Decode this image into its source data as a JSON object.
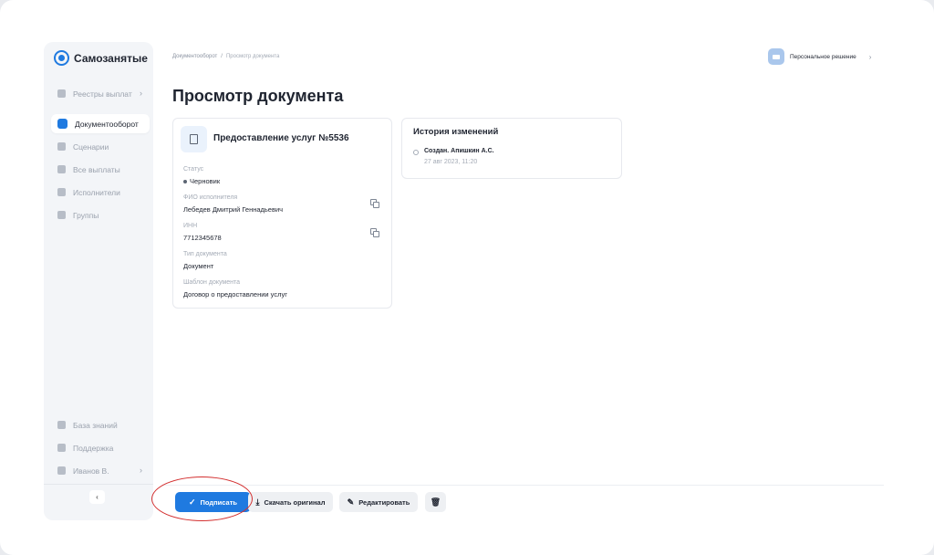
{
  "brand": {
    "name": "Самозанятые"
  },
  "sidebar": {
    "items": [
      {
        "label": "Реестры выплат",
        "has_chevron": true,
        "chevron": "›"
      },
      {
        "label": "Документооборот",
        "active": true
      },
      {
        "label": "Сценарии"
      },
      {
        "label": "Все выплаты"
      },
      {
        "label": "Исполнители"
      },
      {
        "label": "Группы"
      }
    ],
    "bottom_items": [
      {
        "label": "База знаний"
      },
      {
        "label": "Поддержка"
      },
      {
        "label": "Иванов В.",
        "has_chevron": true,
        "chevron": "›"
      }
    ],
    "collapse_glyph": "‹"
  },
  "header": {
    "breadcrumb": [
      "Документооборот",
      "Просмотр документа"
    ],
    "breadcrumb_separator": "/",
    "account_name": "Персональное решение",
    "account_chevron": "›"
  },
  "page": {
    "title": "Просмотр документа"
  },
  "document": {
    "title": "Предоставление услуг №5536",
    "fields": {
      "status_label": "Статус",
      "status_value": "Черновик",
      "executor_label": "ФИО исполнителя",
      "executor_value": "Лебедев Дмитрий Геннадьевич",
      "inn_label": "ИНН",
      "inn_value": "7712345678",
      "doc_type_label": "Тип документа",
      "doc_type_value": "Документ",
      "template_label": "Шаблон документа",
      "template_value": "Договор о предоставлении услуг"
    }
  },
  "history": {
    "title": "История  изменений",
    "entries": [
      {
        "text": "Создан. Апишкин А.С.",
        "date": "27 авг 2023, 11:20"
      }
    ]
  },
  "actions": {
    "sign_label": "Подписать",
    "sign_icon": "✓",
    "download_label": "Скачать оригинал",
    "download_icon": "⤓",
    "edit_label": "Редактировать",
    "edit_icon": "✎",
    "delete_icon": "🗑"
  },
  "colors": {
    "accent": "#1f7ae0",
    "highlight": "#d32f2f"
  }
}
